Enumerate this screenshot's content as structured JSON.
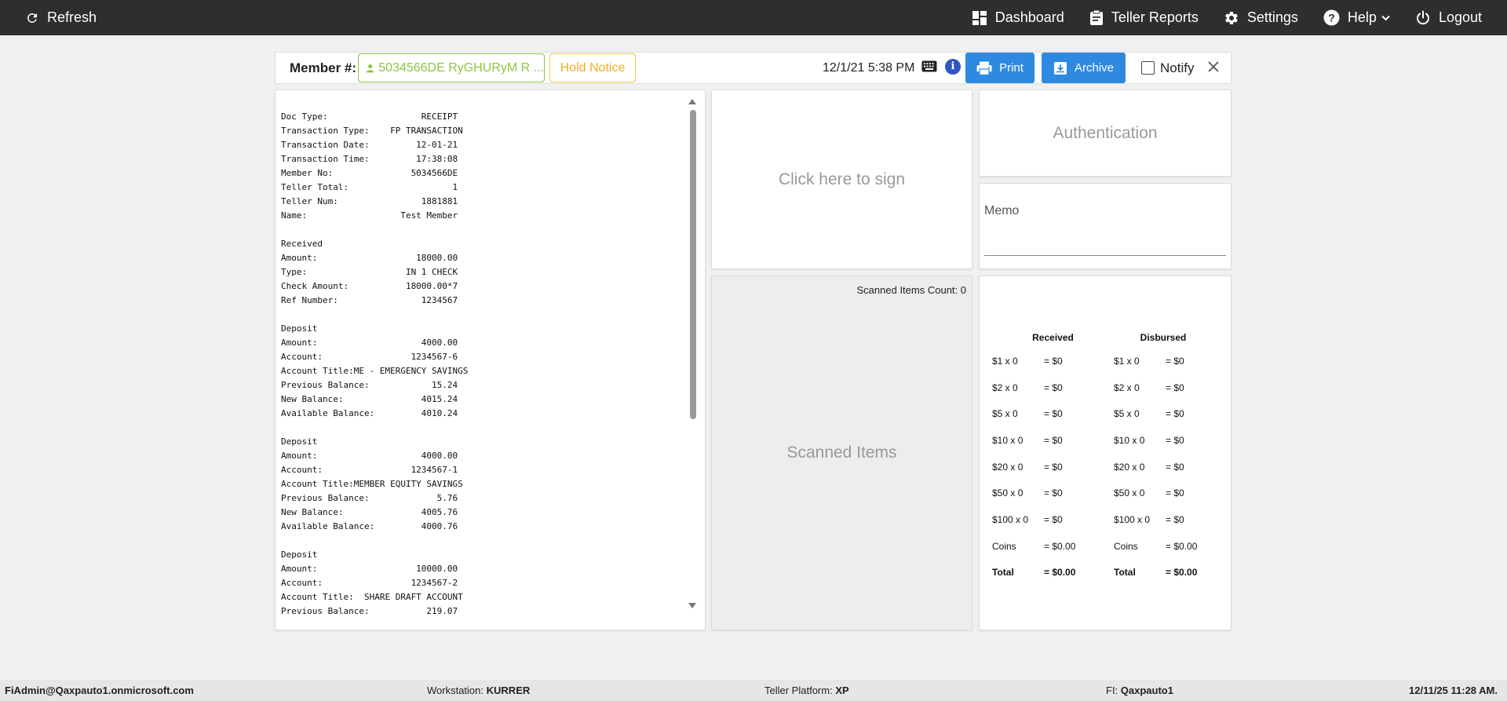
{
  "topbar": {
    "refresh_label": "Refresh",
    "nav": [
      {
        "label": "Dashboard",
        "icon": "dashboard-icon"
      },
      {
        "label": "Teller Reports",
        "icon": "clipboard-icon"
      },
      {
        "label": "Settings",
        "icon": "gear-icon"
      },
      {
        "label": "Help",
        "icon": "help-icon"
      },
      {
        "label": "Logout",
        "icon": "power-icon"
      }
    ]
  },
  "header": {
    "member_label": "Member #:",
    "member_value": "5034566DE RyGHURyM R ...",
    "hold_notice": "Hold Notice",
    "datetime": "12/1/21 5:38 PM",
    "print_label": "Print",
    "archive_label": "Archive",
    "notify_label": "Notify"
  },
  "receipt": {
    "text": "Doc Type:                  RECEIPT\nTransaction Type:    FP TRANSACTION\nTransaction Date:         12-01-21\nTransaction Time:         17:38:08\nMember No:               5034566DE\nTeller Total:                    1\nTeller Num:                1881881\nName:                  Test Member\n\nReceived\nAmount:                   18000.00\nType:                   IN 1 CHECK\nCheck Amount:           18000.00*7\nRef Number:                1234567\n\nDeposit\nAmount:                    4000.00\nAccount:                 1234567-6\nAccount Title:ME - EMERGENCY SAVINGS\nPrevious Balance:            15.24\nNew Balance:               4015.24\nAvailable Balance:         4010.24\n\nDeposit\nAmount:                    4000.00\nAccount:                 1234567-1\nAccount Title:MEMBER EQUITY SAVINGS\nPrevious Balance:             5.76\nNew Balance:               4005.76\nAvailable Balance:         4000.76\n\nDeposit\nAmount:                   10000.00\nAccount:                 1234567-2\nAccount Title:  SHARE DRAFT ACCOUNT\nPrevious Balance:           219.07"
  },
  "sign_label": "Click here to sign",
  "scanned": {
    "count_label": "Scanned Items Count: 0",
    "title": "Scanned Items"
  },
  "auth_label": "Authentication",
  "memo": {
    "label": "Memo",
    "value": ""
  },
  "cash": {
    "received_header": "Received",
    "disbursed_header": "Disbursed",
    "rows": [
      {
        "received_denom": "$1 x 0",
        "received_amount": "= $0",
        "disbursed_denom": "$1 x 0",
        "disbursed_amount": "= $0"
      },
      {
        "received_denom": "$2 x 0",
        "received_amount": "= $0",
        "disbursed_denom": "$2 x 0",
        "disbursed_amount": "= $0"
      },
      {
        "received_denom": "$5 x 0",
        "received_amount": "= $0",
        "disbursed_denom": "$5 x 0",
        "disbursed_amount": "= $0"
      },
      {
        "received_denom": "$10 x 0",
        "received_amount": "= $0",
        "disbursed_denom": "$10 x 0",
        "disbursed_amount": "= $0"
      },
      {
        "received_denom": "$20 x 0",
        "received_amount": "= $0",
        "disbursed_denom": "$20 x 0",
        "disbursed_amount": "= $0"
      },
      {
        "received_denom": "$50 x 0",
        "received_amount": "= $0",
        "disbursed_denom": "$50 x 0",
        "disbursed_amount": "= $0"
      },
      {
        "received_denom": "$100 x 0",
        "received_amount": "= $0",
        "disbursed_denom": "$100 x 0",
        "disbursed_amount": "= $0"
      },
      {
        "received_denom": "Coins",
        "received_amount": "= $0.00",
        "disbursed_denom": "Coins",
        "disbursed_amount": "= $0.00"
      }
    ],
    "total": {
      "received_label": "Total",
      "received_amount": "= $0.00",
      "disbursed_label": "Total",
      "disbursed_amount": "= $0.00"
    }
  },
  "footer": {
    "user": "FiAdmin@Qaxpauto1.onmicrosoft.com",
    "workstation_label": "Workstation:",
    "workstation": "KURRER",
    "platform_label": "Teller Platform:",
    "platform": "XP",
    "fi_label": "FI:",
    "fi": "Qaxpauto1",
    "timestamp": "12/11/25 11:28 AM."
  },
  "colors": {
    "topbar": "#2e2e2e",
    "accent_blue": "#2d8ae0",
    "member_green": "#8cc63f",
    "hold_yellow": "#f4c542",
    "info_blue": "#2f54c4"
  }
}
